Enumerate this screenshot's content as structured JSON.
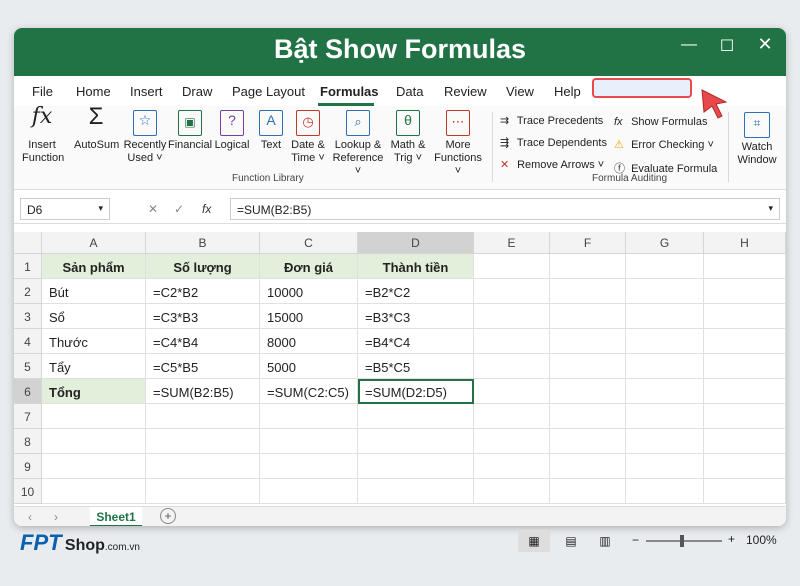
{
  "title": "Bật Show Formulas",
  "menu": [
    "File",
    "Home",
    "Insert",
    "Draw",
    "Page Layout",
    "Formulas",
    "Data",
    "Review",
    "View",
    "Help"
  ],
  "ribbon": {
    "insert_function": [
      "Insert",
      "Function"
    ],
    "autosum": [
      "AutoSum"
    ],
    "recently": [
      "Recently",
      "Used ˅"
    ],
    "financial": [
      "Financial"
    ],
    "logical": [
      "Logical"
    ],
    "text": [
      "Text"
    ],
    "datetime": [
      "Date &",
      "Time ˅"
    ],
    "lookup": [
      "Lookup &",
      "Reference ˅"
    ],
    "math": [
      "Math &",
      "Trig ˅"
    ],
    "more": [
      "More",
      "Functions ˅"
    ],
    "function_library": "Function Library",
    "trace_precedents": "Trace Precedents",
    "trace_dependents": "Trace Dependents",
    "remove_arrows": "Remove Arrows ˅",
    "show_formulas": "Show Formulas",
    "error_checking": "Error Checking ˅",
    "evaluate_formula": "Evaluate Formula",
    "formula_auditing": "Formula Auditing",
    "watch": [
      "Watch",
      "Window"
    ]
  },
  "namebox": "D6",
  "formula": "=SUM(B2:B5)",
  "columns": [
    "A",
    "B",
    "C",
    "D",
    "E",
    "F",
    "G",
    "H"
  ],
  "rows": [
    "1",
    "2",
    "3",
    "4",
    "5",
    "6",
    "7",
    "8",
    "9",
    "10"
  ],
  "cells": [
    [
      "Sản phẩm",
      "Số lượng",
      "Đơn giá",
      "Thành tiền"
    ],
    [
      "Bút",
      "=C2*B2",
      "10000",
      "=B2*C2"
    ],
    [
      "Sổ",
      "=C3*B3",
      "15000",
      "=B3*C3"
    ],
    [
      "Thước",
      "=C4*B4",
      "8000",
      "=B4*C4"
    ],
    [
      "Tẩy",
      "=C5*B5",
      "5000",
      "=B5*C5"
    ],
    [
      "Tổng",
      "=SUM(B2:B5)",
      "=SUM(C2:C5)",
      "=SUM(D2:D5)"
    ]
  ],
  "sheet": "Sheet1",
  "zoom": "100%",
  "brand": "FPT",
  "brand_shop": "Shop",
  "brand_domain": ".com.vn",
  "colors": {
    "accent": "#217346",
    "header_fill": "#e2efda",
    "highlight": "#e8494a"
  }
}
